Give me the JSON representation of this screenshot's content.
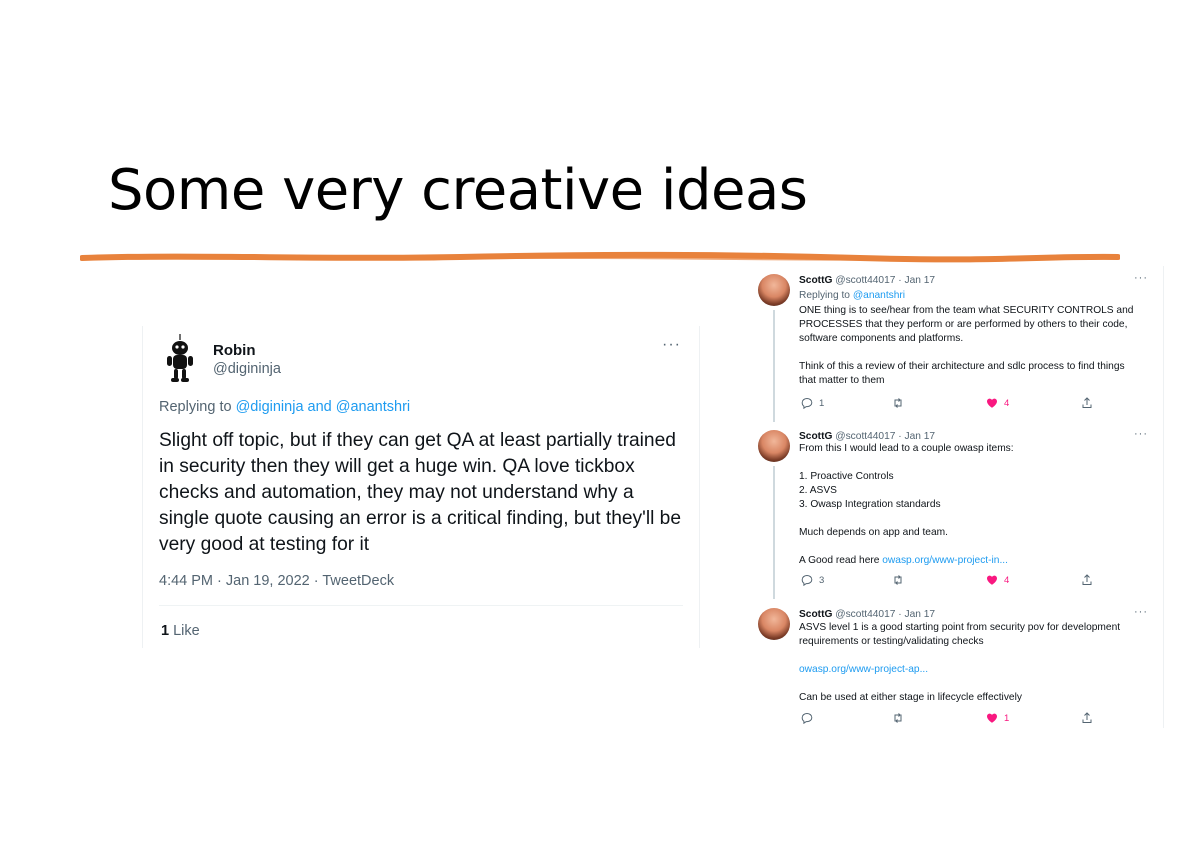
{
  "slide": {
    "title": "Some very creative ideas",
    "accent": "#e8823c"
  },
  "left_tweet": {
    "name": "Robin",
    "handle": "@digininja",
    "more": "···",
    "replying_prefix": "Replying to",
    "replying_to": "@digininja and @anantshri",
    "body": "Slight off topic, but if they can get QA at least partially trained in security then they will get a huge win. QA love tickbox checks and automation, they may not understand why a single quote causing an error is a critical finding, but they'll be very good at testing for it",
    "meta": "4:44 PM · Jan 19, 2022 · TweetDeck",
    "likes_count": "1",
    "likes_label": "Like"
  },
  "thread": {
    "more": "···",
    "tweets": [
      {
        "name": "ScottG",
        "handle_date": "@scott44017 · Jan 17",
        "replying_prefix": "Replying to",
        "replying_to": "@anantshri",
        "lines": [
          "ONE thing is to see/hear from the team what SECURITY CONTROLS and",
          "PROCESSES that they perform or are performed by others to their code,",
          "software components and platforms.",
          "",
          "Think of this a review of their architecture and sdlc process to find things",
          "that matter to them"
        ],
        "replies": "1",
        "retweets": "",
        "likes": "4"
      },
      {
        "name": "ScottG",
        "handle_date": "@scott44017 · Jan 17",
        "lines": [
          "From this I would lead to a couple owasp items:",
          "",
          "1. Proactive Controls",
          "2. ASVS",
          "3. Owasp Integration standards",
          "",
          "Much depends on app and team.",
          ""
        ],
        "link_prefix": "A Good read here ",
        "link": "owasp.org/www-project-in...",
        "replies": "3",
        "retweets": "",
        "likes": "4"
      },
      {
        "name": "ScottG",
        "handle_date": "@scott44017 · Jan 17",
        "lines": [
          "ASVS level 1 is a good starting point from security pov for development",
          "requirements or testing/validating checks",
          ""
        ],
        "link": "owasp.org/www-project-ap...",
        "after_link": "Can be used at either stage in lifecycle effectively",
        "replies": "",
        "retweets": "",
        "likes": "1"
      }
    ]
  }
}
